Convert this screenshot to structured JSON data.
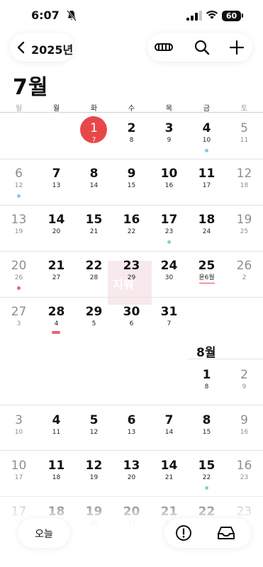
{
  "status": {
    "time": "6:07",
    "battery": "60"
  },
  "nav": {
    "back_label": "2025년"
  },
  "month_title": "7월",
  "weekdays": [
    "일",
    "월",
    "화",
    "수",
    "목",
    "금",
    "토"
  ],
  "watermark": "지워",
  "august_title": "8월",
  "weeks": [
    [
      null,
      null,
      {
        "n": "1",
        "s": "7"
      },
      {
        "n": "2",
        "s": "8"
      },
      {
        "n": "3",
        "s": "9"
      },
      {
        "n": "4",
        "s": "10"
      },
      {
        "n": "5",
        "s": "11"
      }
    ],
    [
      {
        "n": "6",
        "s": "12"
      },
      {
        "n": "7",
        "s": "13"
      },
      {
        "n": "8",
        "s": "14"
      },
      {
        "n": "9",
        "s": "15"
      },
      {
        "n": "10",
        "s": "16"
      },
      {
        "n": "11",
        "s": "17"
      },
      {
        "n": "12",
        "s": "18"
      }
    ],
    [
      {
        "n": "13",
        "s": "19"
      },
      {
        "n": "14",
        "s": "20"
      },
      {
        "n": "15",
        "s": "21"
      },
      {
        "n": "16",
        "s": "22"
      },
      {
        "n": "17",
        "s": "23"
      },
      {
        "n": "18",
        "s": "24"
      },
      {
        "n": "19",
        "s": "25"
      }
    ],
    [
      {
        "n": "20",
        "s": "26"
      },
      {
        "n": "21",
        "s": "27"
      },
      {
        "n": "22",
        "s": "28"
      },
      {
        "n": "23",
        "s": "29"
      },
      {
        "n": "24",
        "s": "30"
      },
      {
        "n": "25",
        "s": "윤6월"
      },
      {
        "n": "26",
        "s": "2"
      }
    ],
    [
      {
        "n": "27",
        "s": "3"
      },
      {
        "n": "28",
        "s": "4"
      },
      {
        "n": "29",
        "s": "5"
      },
      {
        "n": "30",
        "s": "6"
      },
      {
        "n": "31",
        "s": "7"
      },
      null,
      null
    ],
    [
      null,
      null,
      null,
      null,
      null,
      {
        "n": "1",
        "s": "8"
      },
      {
        "n": "2",
        "s": "9"
      }
    ],
    [
      {
        "n": "3",
        "s": "10"
      },
      {
        "n": "4",
        "s": "11"
      },
      {
        "n": "5",
        "s": "12"
      },
      {
        "n": "6",
        "s": "13"
      },
      {
        "n": "7",
        "s": "14"
      },
      {
        "n": "8",
        "s": "15"
      },
      {
        "n": "9",
        "s": "16"
      }
    ],
    [
      {
        "n": "10",
        "s": "17"
      },
      {
        "n": "11",
        "s": "18"
      },
      {
        "n": "12",
        "s": "19"
      },
      {
        "n": "13",
        "s": "20"
      },
      {
        "n": "14",
        "s": "21"
      },
      {
        "n": "15",
        "s": "22"
      },
      {
        "n": "16",
        "s": "23"
      }
    ],
    [
      {
        "n": "17",
        "s": "24"
      },
      {
        "n": "18",
        "s": "25"
      },
      {
        "n": "19",
        "s": "26"
      },
      {
        "n": "20",
        "s": "27"
      },
      {
        "n": "21",
        "s": "28"
      },
      {
        "n": "22",
        "s": "29"
      },
      {
        "n": "23",
        "s": "30"
      }
    ]
  ],
  "today": {
    "week": 0,
    "col": 2
  },
  "leap_month_day": {
    "week": 3,
    "col": 5
  },
  "event_markers": [
    {
      "week": 0,
      "col": 5,
      "kind": "dot",
      "color": "#8ec6e6"
    },
    {
      "week": 1,
      "col": 0,
      "kind": "dot",
      "color": "#8ec6e6"
    },
    {
      "week": 2,
      "col": 4,
      "kind": "dot",
      "color": "#8fd0b8"
    },
    {
      "week": 3,
      "col": 0,
      "kind": "dot",
      "color": "#e6637a"
    },
    {
      "week": 4,
      "col": 1,
      "kind": "bar",
      "color": "#e6637a"
    },
    {
      "week": 7,
      "col": 5,
      "kind": "dot",
      "color": "#8fd0b8"
    }
  ],
  "colors": {
    "accent": "#e8474a",
    "weekend_text": "#8e8e8e"
  },
  "bottom": {
    "today_label": "오늘"
  },
  "icons": [
    "bell-off-icon",
    "signal-icon",
    "wifi-icon",
    "battery-icon",
    "chevron-left-icon",
    "view-toggle-icon",
    "search-icon",
    "plus-icon",
    "alert-icon",
    "inbox-icon"
  ]
}
